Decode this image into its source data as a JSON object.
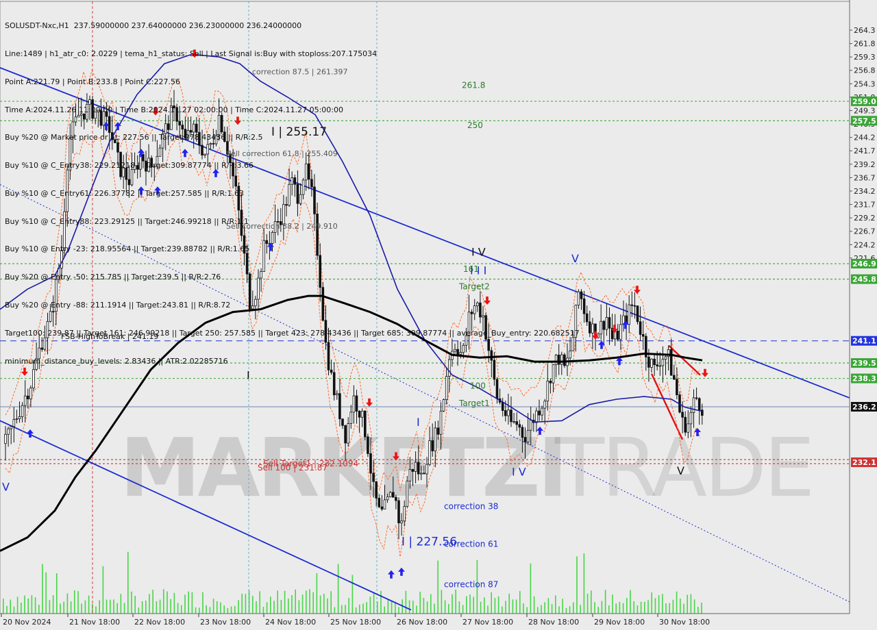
{
  "header": {
    "lines": [
      "SOLUSDT-Nxc,H1  237.59000000 237.64000000 236.23000000 236.24000000",
      "Line:1489 | h1_atr_c0: 2.0229 | tema_h1_status: Sell | Last Signal is:Buy with stoploss:207.175034",
      "Point A:221.79 | Point B:233.8 | Point C:227.56",
      "Time A:2024.11.26 11:00:00 | Time B:2024.11.27 02:00:00 | Time C:2024.11.27 05:00:00",
      "Buy %20 @ Market price or at: 227.56 || Target:278.43436 || R/R:2.5",
      "Buy %10 @ C_Entry38: 229.21218 || Target:309.87774 || R/R:3.66",
      "Buy %10 @ C_Entry61: 226.37782 || Target:257.585 || R/R:1.63",
      "Buy %10 @ C_Entry88: 223.29125 || Target:246.99218 || R/R:1.1",
      "Buy %10 @ Entry -23: 218.95564 || Target:239.88782 || R/R:1.65",
      "Buy %20 @ Entry -50: 215.785 || Target:239.5 || R/R:2.76",
      "Buy %20 @ Entry -88: 211.1914 || Target:243.81 || R/R:8.72",
      "Target100: 239.87 || Target 161: 246.99218 || Target 250: 257.585 || Target 423: 278.43436 || Target 685: 309.87774 || average_Buy_entry: 220.682517",
      "minimum_distance_buy_levels: 2.83436 || ATR:2.02285716"
    ]
  },
  "watermark": {
    "left": "MARKETZI",
    "right": "TRADE"
  },
  "chart_data": {
    "type": "candlestick",
    "symbol": "SOLUSDT-Nxc",
    "timeframe": "H1",
    "y_range": [
      220.6,
      266.3
    ],
    "y_ticks": [
      "264.3",
      "261.8",
      "259.3",
      "256.8",
      "254.3",
      "251.8",
      "249.3",
      "246.9",
      "244.2",
      "241.7",
      "239.2",
      "236.7",
      "234.2",
      "231.7",
      "229.2",
      "226.7",
      "224.2",
      "221.6"
    ],
    "x_ticks": [
      "20 Nov 2024",
      "21 Nov 18:00",
      "22 Nov 18:00",
      "23 Nov 18:00",
      "24 Nov 18:00",
      "25 Nov 18:00",
      "26 Nov 18:00",
      "27 Nov 18:00",
      "28 Nov 18:00",
      "29 Nov 18:00",
      "30 Nov 18:00"
    ],
    "price_tags": [
      {
        "label": "259.0",
        "value": 259.0,
        "color": "#3aa635"
      },
      {
        "label": "257.5",
        "value": 257.55,
        "color": "#3aa635"
      },
      {
        "label": "246.9",
        "value": 246.9,
        "color": "#3aa635"
      },
      {
        "label": "245.8",
        "value": 245.75,
        "color": "#3aa635"
      },
      {
        "label": "241.1",
        "value": 241.15,
        "color": "#2233dd"
      },
      {
        "label": "239.5",
        "value": 239.5,
        "color": "#3aa635"
      },
      {
        "label": "238.3",
        "value": 238.35,
        "color": "#3aa635"
      },
      {
        "label": "236.2",
        "value": 236.24,
        "color": "#111111"
      },
      {
        "label": "232.1",
        "value": 232.1,
        "color": "#cc3333"
      }
    ],
    "levels": [
      {
        "value": 259.0,
        "color": "#3aa635",
        "dash": "3,3"
      },
      {
        "value": 257.55,
        "color": "#3aa635",
        "dash": "3,3"
      },
      {
        "value": 246.9,
        "color": "#3aa635",
        "dash": "3,3"
      },
      {
        "value": 245.75,
        "color": "#3aa635",
        "dash": "3,3"
      },
      {
        "value": 241.15,
        "color": "#2233cc",
        "dash": "9,6"
      },
      {
        "value": 239.5,
        "color": "#3aa635",
        "dash": "3,3"
      },
      {
        "value": 238.35,
        "color": "#3aa635",
        "dash": "3,3"
      },
      {
        "value": 236.24,
        "color": "#6c8ab0",
        "dash": ""
      },
      {
        "value": 232.3,
        "color": "#cc3333",
        "dash": "3,3"
      },
      {
        "value": 232.0,
        "color": "#cc3333",
        "dash": "3,3"
      }
    ],
    "zones": [
      {
        "x1": 383,
        "x2": 487,
        "y1": 265.2,
        "y2": 260.8,
        "color": "#f0a060"
      },
      {
        "x1": 383,
        "x2": 487,
        "y1": 260.8,
        "y2": 230.6,
        "color": "#4ddf2a"
      },
      {
        "x1": 402,
        "x2": 467,
        "y1": 230.6,
        "y2": 220.9,
        "color": "#4ddf2a"
      },
      {
        "x1": 668,
        "x2": 695,
        "y1": 258.7,
        "y2": 231.6,
        "color": "#4ddf2a"
      },
      {
        "x1": 651,
        "x2": 713,
        "y1": 246.9,
        "y2": 231.6,
        "color": "#4ddf2a"
      },
      {
        "x1": 631,
        "x2": 734,
        "y1": 239.4,
        "y2": 223.6,
        "color": "#4ddf2a"
      },
      {
        "x1": 631,
        "x2": 734,
        "y1": 223.6,
        "y2": 221.0,
        "color": "#f0a060"
      }
    ],
    "annotations": [
      {
        "text": "I | 255.17",
        "value": 256.45,
        "x": 396,
        "size": 17,
        "color": "#111"
      },
      {
        "text": "correction 87.5 | 261.397",
        "value": 261.0,
        "x": 368,
        "size": 11,
        "color": "#555"
      },
      {
        "text": "Sell correction 61.8 | 255.409",
        "value": 254.9,
        "x": 330,
        "size": 11,
        "color": "#555"
      },
      {
        "text": "Sell correction 38.2 | 249.910",
        "value": 249.5,
        "x": 330,
        "size": 11,
        "color": "#555"
      },
      {
        "text": "261.8",
        "value": 260.0,
        "x": 674,
        "size": 12,
        "color": "#2a7a2a"
      },
      {
        "text": "250",
        "value": 257.0,
        "x": 682,
        "size": 12,
        "color": "#2a7a2a"
      },
      {
        "text": "I V",
        "value": 247.5,
        "x": 688,
        "size": 16,
        "color": "#111"
      },
      {
        "text": "161",
        "value": 246.3,
        "x": 676,
        "size": 12,
        "color": "#2a7a2a"
      },
      {
        "text": "I I I",
        "value": 246.1,
        "x": 686,
        "size": 16,
        "color": "#1a2ad0"
      },
      {
        "text": "Target2",
        "value": 245.0,
        "x": 670,
        "size": 12,
        "color": "#2a7a2a"
      },
      {
        "text": "FSB-HighToBreak | 241.19",
        "value": 241.3,
        "x": 89,
        "size": 11,
        "color": "#111"
      },
      {
        "text": "100",
        "value": 237.6,
        "x": 686,
        "size": 12,
        "color": "#2a7a2a"
      },
      {
        "text": "Target1",
        "value": 236.3,
        "x": 670,
        "size": 12,
        "color": "#2a7a2a"
      },
      {
        "text": "V",
        "value": 247.0,
        "x": 834,
        "size": 16,
        "color": "#1a2ad0"
      },
      {
        "text": "I",
        "value": 238.3,
        "x": 360,
        "size": 16,
        "color": "#111"
      },
      {
        "text": "I",
        "value": 234.8,
        "x": 608,
        "size": 16,
        "color": "#1a2ad0"
      },
      {
        "text": "Sell Target1 | 232.1094",
        "value": 231.8,
        "x": 384,
        "size": 12,
        "color": "#cc3333"
      },
      {
        "text": "Sell 100 | 231.87",
        "value": 231.5,
        "x": 376,
        "size": 12,
        "color": "#cc3333"
      },
      {
        "text": "I V",
        "value": 231.1,
        "x": 747,
        "size": 16,
        "color": "#1a2ad0"
      },
      {
        "text": "V",
        "value": 231.2,
        "x": 988,
        "size": 16,
        "color": "#111"
      },
      {
        "text": "V",
        "value": 230.0,
        "x": 3,
        "size": 16,
        "color": "#1a2ad0"
      },
      {
        "text": "correction 38",
        "value": 228.6,
        "x": 648,
        "size": 12,
        "color": "#1a2ad0"
      },
      {
        "text": "I | 227.56",
        "value": 225.9,
        "x": 586,
        "size": 17,
        "color": "#1a2ad0"
      },
      {
        "text": "correction 61",
        "value": 225.8,
        "x": 648,
        "size": 12,
        "color": "#1a2ad0"
      },
      {
        "text": "correction 87",
        "value": 222.8,
        "x": 648,
        "size": 12,
        "color": "#1a2ad0"
      }
    ],
    "trendlines": [
      {
        "x1": 0,
        "y1": 261.5,
        "x2": 1240,
        "y2": 236.9,
        "color": "#1a2ad0",
        "width": 1.8,
        "dash": ""
      },
      {
        "x1": 0,
        "y1": 235.2,
        "x2": 600,
        "y2": 221.1,
        "color": "#1a2ad0",
        "width": 1.8,
        "dash": ""
      },
      {
        "x1": 0,
        "y1": 252.8,
        "x2": 1240,
        "y2": 221.7,
        "color": "#1a2ad0",
        "width": 1.0,
        "dash": "2,3"
      },
      {
        "x1": 976,
        "y1": 240.8,
        "x2": 1022,
        "y2": 238.6,
        "color": "#e01010",
        "width": 2.4,
        "dash": ""
      },
      {
        "x1": 951,
        "y1": 238.7,
        "x2": 996,
        "y2": 233.8,
        "color": "#e01010",
        "width": 2.4,
        "dash": ""
      }
    ],
    "vlines": [
      {
        "x": 135,
        "color": "#cc4444",
        "dash": "4,3"
      },
      {
        "x": 363,
        "color": "#66b0c0",
        "dash": "3,3"
      },
      {
        "x": 550,
        "color": "#66b0c0",
        "dash": "3,3"
      }
    ],
    "close_series": [
      [
        8,
        233.5
      ],
      [
        28,
        236
      ],
      [
        45,
        238
      ],
      [
        60,
        241
      ],
      [
        75,
        243
      ],
      [
        90,
        248
      ],
      [
        100,
        256
      ],
      [
        115,
        258
      ],
      [
        130,
        258.5
      ],
      [
        145,
        258
      ],
      [
        160,
        257
      ],
      [
        175,
        254
      ],
      [
        190,
        253
      ],
      [
        205,
        255
      ],
      [
        220,
        254
      ],
      [
        235,
        256
      ],
      [
        250,
        258
      ],
      [
        260,
        258
      ],
      [
        270,
        256
      ],
      [
        280,
        257
      ],
      [
        290,
        256
      ],
      [
        300,
        255
      ],
      [
        310,
        256
      ],
      [
        320,
        258
      ],
      [
        330,
        256
      ],
      [
        345,
        252
      ],
      [
        355,
        248
      ],
      [
        365,
        244
      ],
      [
        375,
        245
      ],
      [
        385,
        248
      ],
      [
        395,
        249
      ],
      [
        405,
        250
      ],
      [
        415,
        251
      ],
      [
        425,
        253
      ],
      [
        435,
        252
      ],
      [
        445,
        254
      ],
      [
        455,
        252
      ],
      [
        465,
        247
      ],
      [
        475,
        241
      ],
      [
        485,
        238
      ],
      [
        495,
        236
      ],
      [
        505,
        234
      ],
      [
        515,
        237
      ],
      [
        525,
        236
      ],
      [
        535,
        234
      ],
      [
        545,
        230
      ],
      [
        555,
        228
      ],
      [
        565,
        229
      ],
      [
        575,
        230
      ],
      [
        585,
        227
      ],
      [
        595,
        231
      ],
      [
        605,
        232
      ],
      [
        615,
        231
      ],
      [
        625,
        233
      ],
      [
        635,
        234
      ],
      [
        645,
        236
      ],
      [
        655,
        240
      ],
      [
        665,
        241
      ],
      [
        675,
        240
      ],
      [
        685,
        243
      ],
      [
        695,
        244
      ],
      [
        705,
        243
      ],
      [
        715,
        240
      ],
      [
        725,
        237
      ],
      [
        735,
        236
      ],
      [
        745,
        235
      ],
      [
        755,
        235
      ],
      [
        765,
        234
      ],
      [
        775,
        235
      ],
      [
        785,
        236
      ],
      [
        795,
        237
      ],
      [
        805,
        239
      ],
      [
        815,
        240
      ],
      [
        825,
        239
      ],
      [
        835,
        241
      ],
      [
        845,
        245
      ],
      [
        855,
        243
      ],
      [
        865,
        242
      ],
      [
        875,
        242
      ],
      [
        885,
        243
      ],
      [
        895,
        241
      ],
      [
        905,
        242
      ],
      [
        915,
        243
      ],
      [
        925,
        244
      ],
      [
        935,
        242
      ],
      [
        945,
        240
      ],
      [
        955,
        239
      ],
      [
        965,
        240
      ],
      [
        975,
        240
      ],
      [
        985,
        238
      ],
      [
        995,
        235
      ],
      [
        1005,
        235
      ],
      [
        1015,
        237
      ],
      [
        1025,
        236.24
      ]
    ],
    "ma_black": [
      [
        0,
        225.5
      ],
      [
        40,
        226.5
      ],
      [
        80,
        228.5
      ],
      [
        110,
        231
      ],
      [
        140,
        233
      ],
      [
        180,
        236
      ],
      [
        220,
        239
      ],
      [
        260,
        241
      ],
      [
        300,
        242.5
      ],
      [
        340,
        243.3
      ],
      [
        380,
        243.5
      ],
      [
        420,
        244.2
      ],
      [
        450,
        244.5
      ],
      [
        470,
        244.5
      ],
      [
        500,
        244.0
      ],
      [
        540,
        243.3
      ],
      [
        580,
        242.4
      ],
      [
        620,
        241.2
      ],
      [
        660,
        240.1
      ],
      [
        700,
        239.9
      ],
      [
        740,
        240.0
      ],
      [
        780,
        239.6
      ],
      [
        820,
        239.6
      ],
      [
        860,
        239.7
      ],
      [
        900,
        239.9
      ],
      [
        940,
        240.2
      ],
      [
        980,
        240.1
      ],
      [
        1000,
        239.9
      ],
      [
        1025,
        239.7
      ]
    ],
    "ma_blue": [
      [
        0,
        243.5
      ],
      [
        40,
        245
      ],
      [
        80,
        246
      ],
      [
        100,
        248
      ],
      [
        130,
        252
      ],
      [
        160,
        256
      ],
      [
        200,
        259.5
      ],
      [
        240,
        261.8
      ],
      [
        280,
        262.5
      ],
      [
        320,
        262.3
      ],
      [
        350,
        261.8
      ],
      [
        380,
        260.5
      ],
      [
        420,
        259.3
      ],
      [
        460,
        258.0
      ],
      [
        500,
        254.5
      ],
      [
        540,
        250.5
      ],
      [
        580,
        245.0
      ],
      [
        620,
        241.2
      ],
      [
        660,
        238.6
      ],
      [
        700,
        237.6
      ],
      [
        740,
        236.4
      ],
      [
        780,
        235.1
      ],
      [
        820,
        235.2
      ],
      [
        860,
        236.4
      ],
      [
        900,
        236.8
      ],
      [
        940,
        237.0
      ],
      [
        980,
        236.8
      ],
      [
        1000,
        236.2
      ],
      [
        1025,
        235.9
      ]
    ]
  }
}
